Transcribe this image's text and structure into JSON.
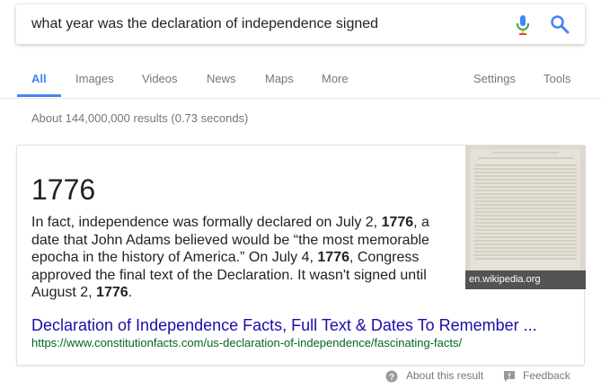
{
  "search": {
    "query": "what year was the declaration of independence signed",
    "mic_icon": "microphone-icon",
    "search_icon": "search-icon"
  },
  "tabs": {
    "items": [
      {
        "label": "All",
        "active": true
      },
      {
        "label": "Images"
      },
      {
        "label": "Videos"
      },
      {
        "label": "News"
      },
      {
        "label": "Maps"
      },
      {
        "label": "More"
      }
    ],
    "right": [
      {
        "label": "Settings"
      },
      {
        "label": "Tools"
      }
    ]
  },
  "stats": "About 144,000,000 results (0.73 seconds)",
  "card": {
    "answer": "1776",
    "snippet": [
      {
        "t": "In fact, independence was formally declared on July 2, "
      },
      {
        "b": "1776"
      },
      {
        "t": ", a date that John Adams believed would be “the most memorable epocha in the history of America.” On July 4, "
      },
      {
        "b": "1776"
      },
      {
        "t": ", Congress approved the final text of the Declaration. It wasn't signed until August 2, "
      },
      {
        "b": "1776"
      },
      {
        "t": "."
      }
    ],
    "image_caption": "en.wikipedia.org",
    "result_title": "Declaration of Independence Facts, Full Text & Dates To Remember ...",
    "result_url": "https://www.constitutionfacts.com/us-declaration-of-independence/fascinating-facts/"
  },
  "footer": {
    "about": "About this result",
    "feedback": "Feedback"
  },
  "colors": {
    "accent": "#4285f4",
    "link": "#1a0dab",
    "url": "#006621"
  }
}
